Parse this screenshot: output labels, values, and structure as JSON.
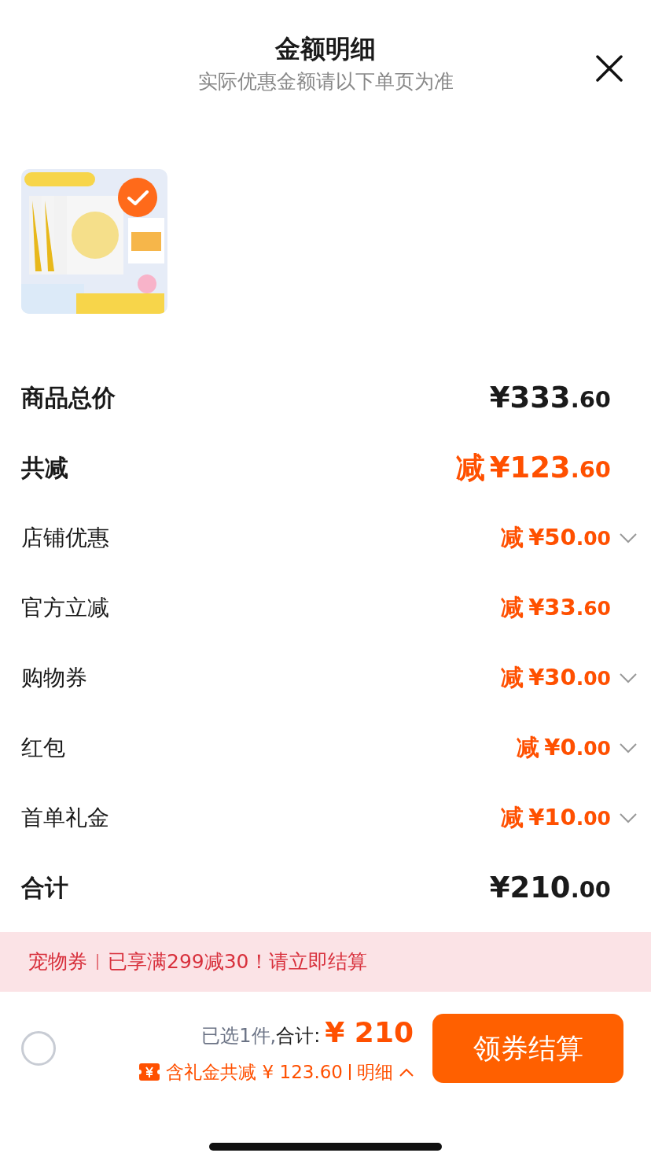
{
  "header": {
    "title": "金额明细",
    "subtitle": "实际优惠金额请以下单页为准"
  },
  "product": {
    "kind": "picture",
    "selected": true
  },
  "rows": [
    {
      "kind": "main",
      "label": "商品总价",
      "prefix": "",
      "amount": "¥333.60",
      "discount": false,
      "expandable": false
    },
    {
      "kind": "main",
      "label": "共减",
      "prefix": "减",
      "amount": "¥123.60",
      "discount": true,
      "expandable": false
    },
    {
      "kind": "sub",
      "label": "店铺优惠",
      "prefix": "减",
      "amount": "¥50.00",
      "discount": true,
      "expandable": true
    },
    {
      "kind": "sub",
      "label": "官方立减",
      "prefix": "减",
      "amount": "¥33.60",
      "discount": true,
      "expandable": false
    },
    {
      "kind": "sub",
      "label": "购物券",
      "prefix": "减",
      "amount": "¥30.00",
      "discount": true,
      "expandable": true
    },
    {
      "kind": "sub",
      "label": "红包",
      "prefix": "减",
      "amount": "¥0.00",
      "discount": true,
      "expandable": true
    },
    {
      "kind": "sub",
      "label": "首单礼金",
      "prefix": "减",
      "amount": "¥10.00",
      "discount": true,
      "expandable": true
    },
    {
      "kind": "main",
      "label": "合计",
      "prefix": "",
      "amount": "¥210.00",
      "discount": false,
      "expandable": false
    }
  ],
  "banner": {
    "tag": "宠物券",
    "message": "已享满299减30！请立即结算"
  },
  "footer": {
    "checked": false,
    "selected_count": "已选1件,",
    "total_label": "合计:",
    "total_value": "¥ 210",
    "savings": "含礼金共减 ¥ 123.60",
    "detail_link": "明细",
    "button": "领券结算"
  }
}
